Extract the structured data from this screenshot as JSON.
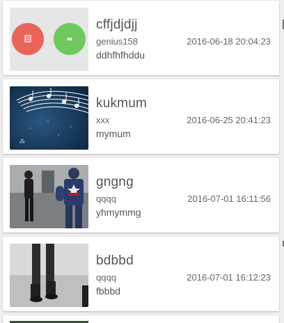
{
  "items": [
    {
      "title": "cffjdjdjj",
      "user": "genius158",
      "description": "ddhfhfhddu",
      "time": "2016-06-18 20:04:23",
      "thumbnail": "placeholder-with-icons",
      "colors": {
        "left_circle": "#e8645a",
        "right_circle": "#6fc95f",
        "placeholder_bg": "#e6e6e6"
      }
    },
    {
      "title": "kukmum",
      "user": "xxx",
      "description": "mymum",
      "time": "2016-06-25 20:41:23",
      "thumbnail": "music-notes-image"
    },
    {
      "title": "gngng",
      "user": "qqqq",
      "description": "yhmymmg",
      "time": "2016-07-01 16:11:56",
      "thumbnail": "superheroes-image"
    },
    {
      "title": "bdbbd",
      "user": "qqqq",
      "description": "fbbbd",
      "time": "2016-07-01 16:12:23",
      "thumbnail": "legs-image"
    }
  ]
}
